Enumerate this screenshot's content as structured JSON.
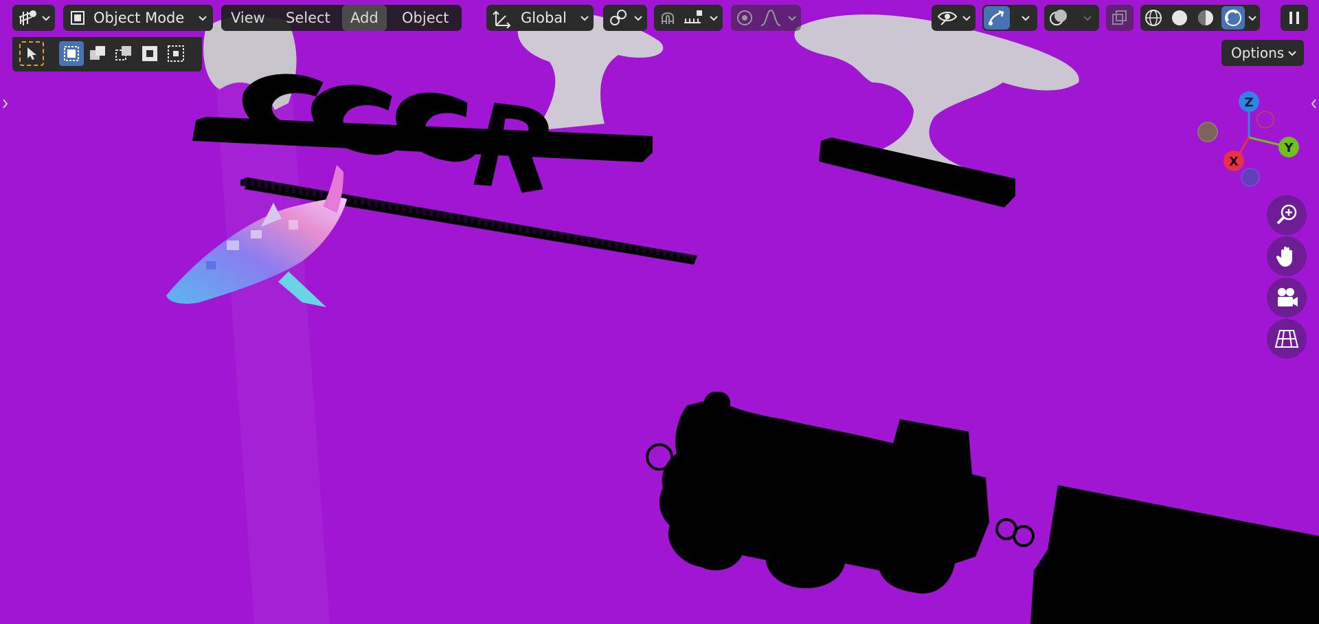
{
  "header": {
    "mode": {
      "label": "Object Mode"
    },
    "menus": [
      {
        "label": "View"
      },
      {
        "label": "Select"
      },
      {
        "label": "Add"
      },
      {
        "label": "Object"
      }
    ],
    "transform": {
      "orientation": "Global"
    }
  },
  "tool_panel": {
    "options_label": "Options"
  },
  "gizmo": {
    "axis_x": "X",
    "axis_y": "Y",
    "axis_z": "Z"
  },
  "scene": {
    "text_mesh": "CGGR"
  },
  "colors": {
    "viewport_bg": "#a016d2",
    "header_bg": "#2b2b2b",
    "active_blue": "#4772b3",
    "axis_x": "#e8304a",
    "axis_y": "#6fbf1f",
    "axis_z": "#2f84e6",
    "nav_btn": "#6f1c97"
  }
}
